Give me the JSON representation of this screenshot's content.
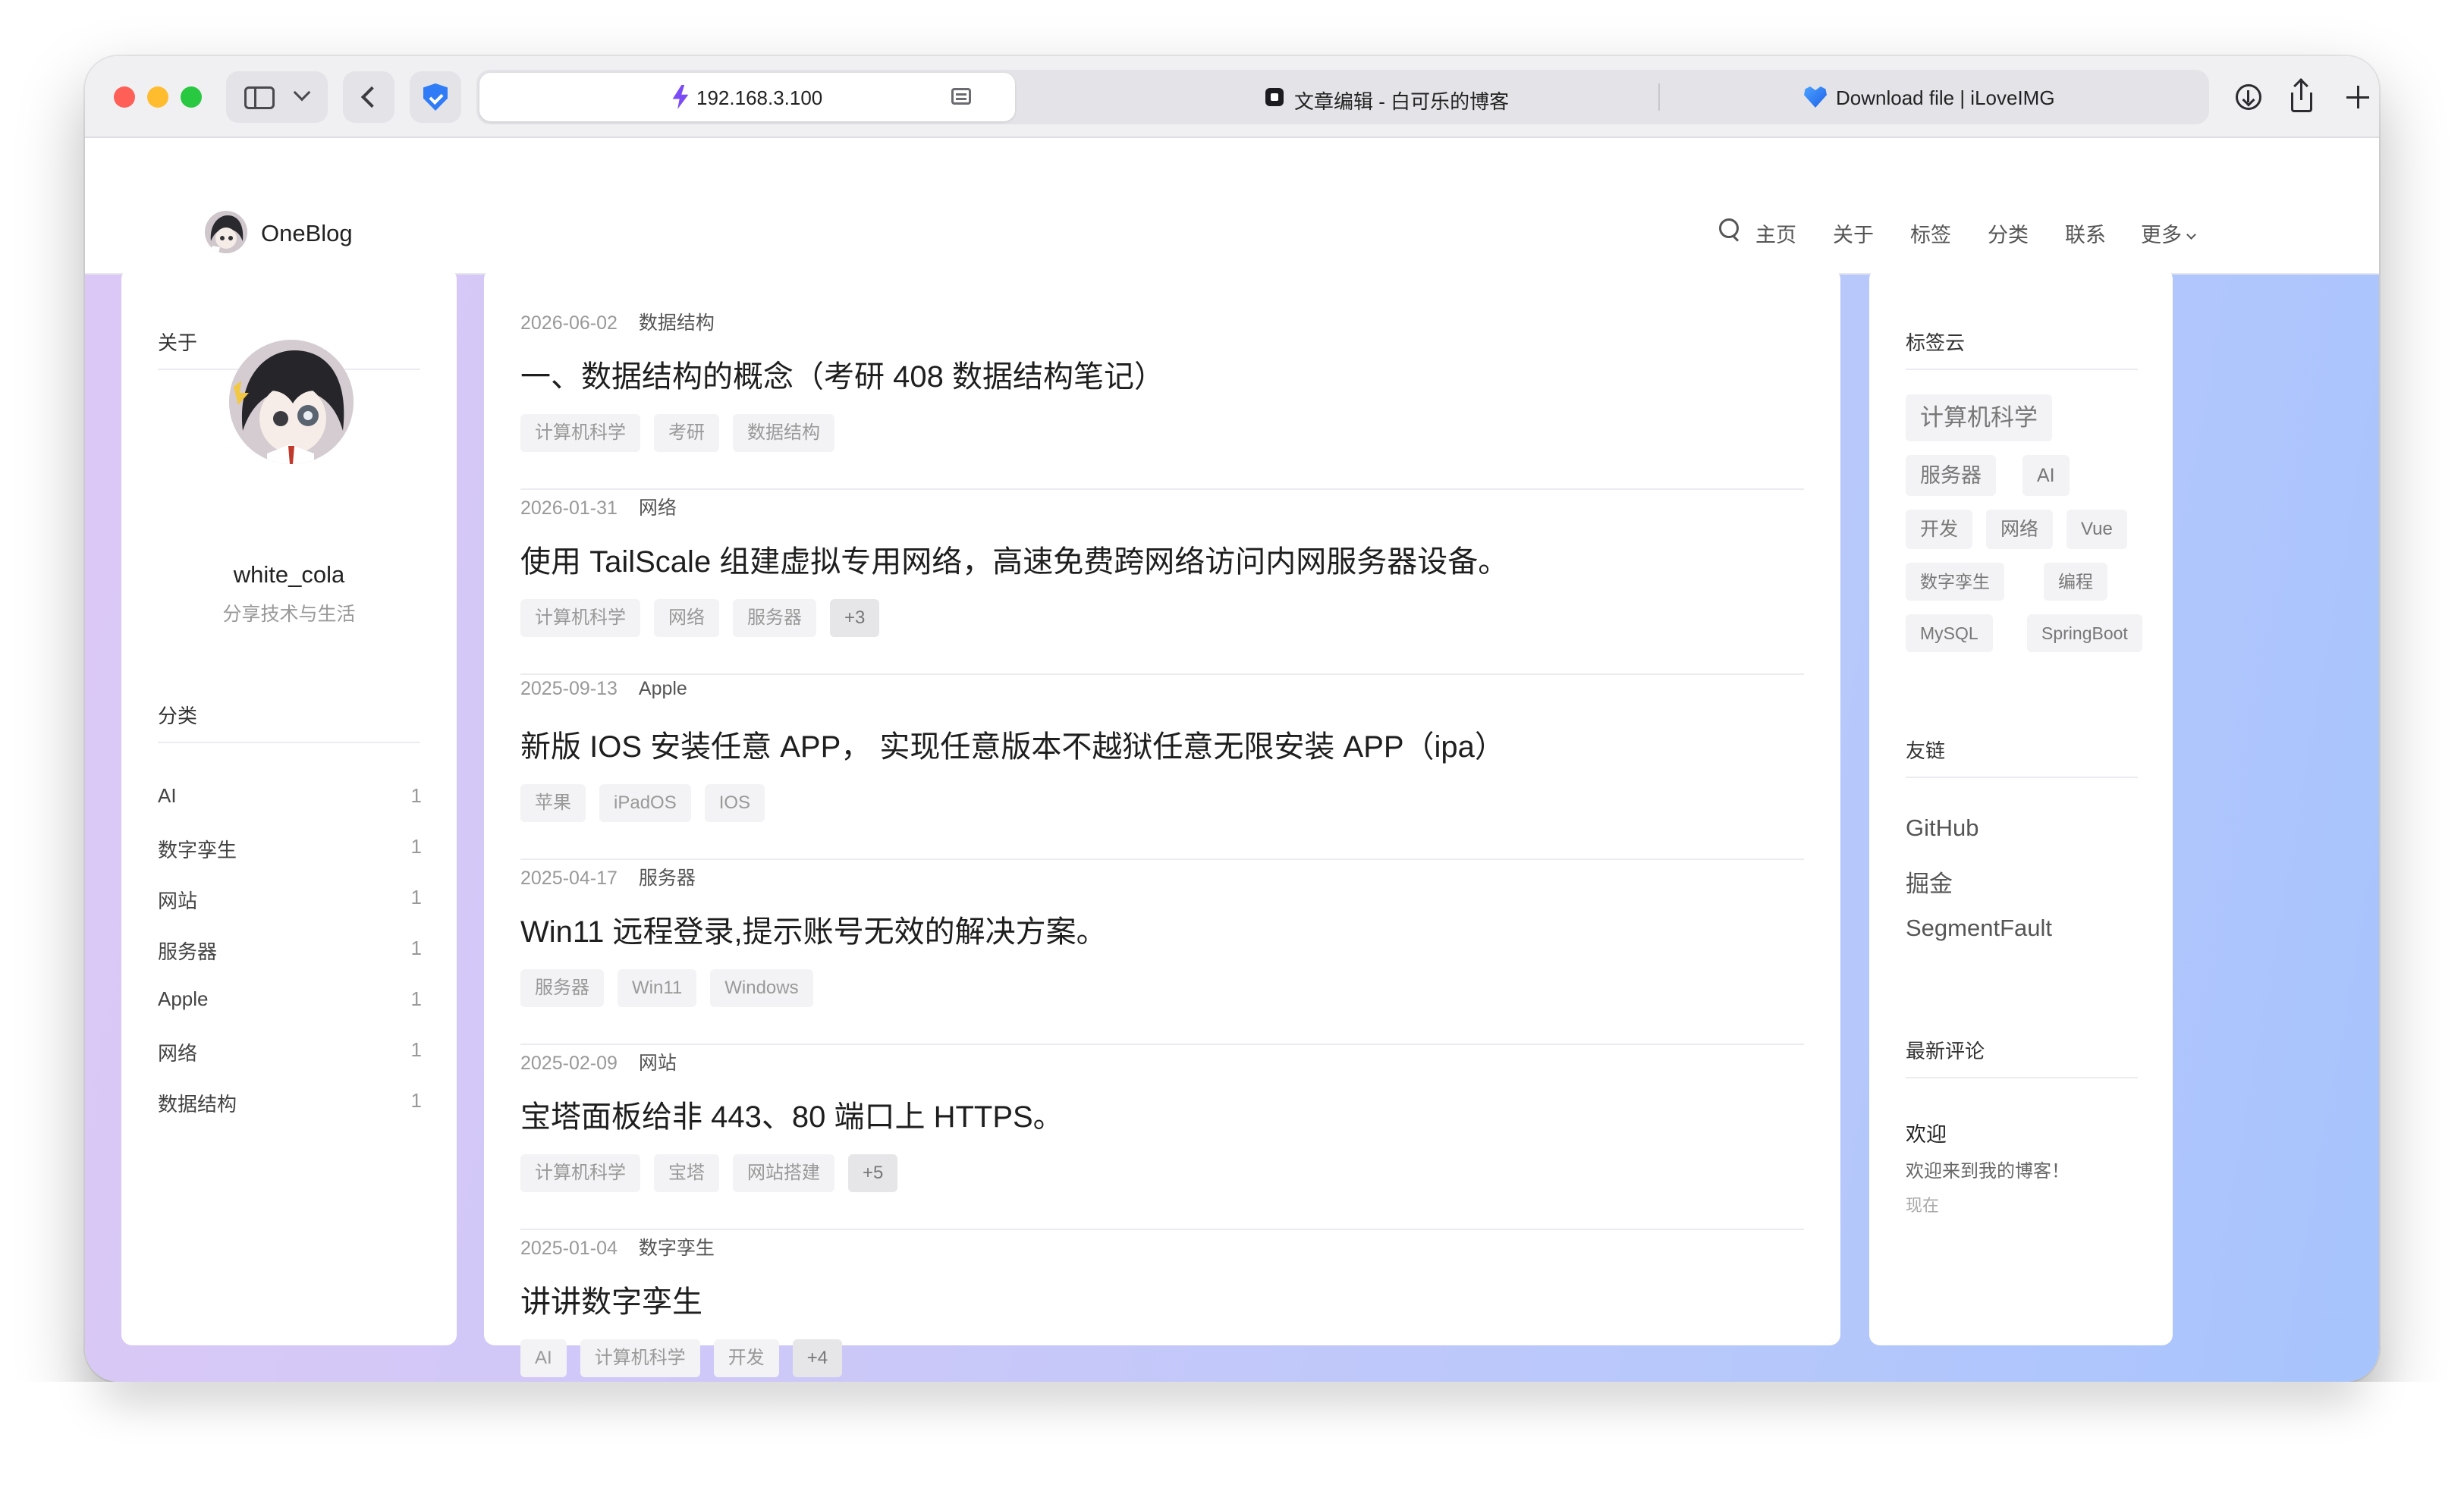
{
  "browser": {
    "address": "192.168.3.100",
    "tabs": [
      {
        "title": "文章编辑 - 白可乐的博客"
      },
      {
        "title": "Download file | iLoveIMG"
      }
    ]
  },
  "site": {
    "logo_text": "OneBlog",
    "nav": [
      "主页",
      "关于",
      "标签",
      "分类",
      "联系",
      "更多"
    ]
  },
  "about": {
    "title": "关于",
    "username": "white_cola",
    "bio": "分享技术与生活"
  },
  "categories": {
    "title": "分类",
    "items": [
      {
        "name": "AI",
        "count": "1"
      },
      {
        "name": "数字孪生",
        "count": "1"
      },
      {
        "name": "网站",
        "count": "1"
      },
      {
        "name": "服务器",
        "count": "1"
      },
      {
        "name": "Apple",
        "count": "1"
      },
      {
        "name": "网络",
        "count": "1"
      },
      {
        "name": "数据结构",
        "count": "1"
      }
    ]
  },
  "posts": [
    {
      "date": "2026-06-02",
      "category": "数据结构",
      "title": "一、数据结构的概念（考研 408 数据结构笔记）",
      "tags": [
        "计算机科学",
        "考研",
        "数据结构"
      ],
      "more": ""
    },
    {
      "date": "2026-01-31",
      "category": "网络",
      "title": "使用 TailScale 组建虚拟专用网络，高速免费跨网络访问内网服务器设备。",
      "tags": [
        "计算机科学",
        "网络",
        "服务器"
      ],
      "more": "+3"
    },
    {
      "date": "2025-09-13",
      "category": "Apple",
      "title": "新版 IOS 安装任意 APP， 实现任意版本不越狱任意无限安装 APP（ipa）",
      "tags": [
        "苹果",
        "iPadOS",
        "IOS"
      ],
      "more": ""
    },
    {
      "date": "2025-04-17",
      "category": "服务器",
      "title": "Win11 远程登录,提示账号无效的解决方案。",
      "tags": [
        "服务器",
        "Win11",
        "Windows"
      ],
      "more": ""
    },
    {
      "date": "2025-02-09",
      "category": "网站",
      "title": "宝塔面板给非 443、80 端口上 HTTPS。",
      "tags": [
        "计算机科学",
        "宝塔",
        "网站搭建"
      ],
      "more": "+5"
    },
    {
      "date": "2025-01-04",
      "category": "数字孪生",
      "title": "讲讲数字孪生",
      "tags": [
        "AI",
        "计算机科学",
        "开发"
      ],
      "more": "+4"
    }
  ],
  "tag_cloud": {
    "title": "标签云",
    "tags": [
      "计算机科学",
      "服务器",
      "AI",
      "开发",
      "网络",
      "Vue",
      "数字孪生",
      "编程",
      "MySQL",
      "SpringBoot"
    ]
  },
  "friends": {
    "title": "友链",
    "links": [
      "GitHub",
      "掘金",
      "SegmentFault"
    ]
  },
  "comments": {
    "title": "最新评论",
    "items": [
      {
        "author": "欢迎",
        "text": "欢迎来到我的博客！",
        "time": "现在"
      }
    ]
  }
}
